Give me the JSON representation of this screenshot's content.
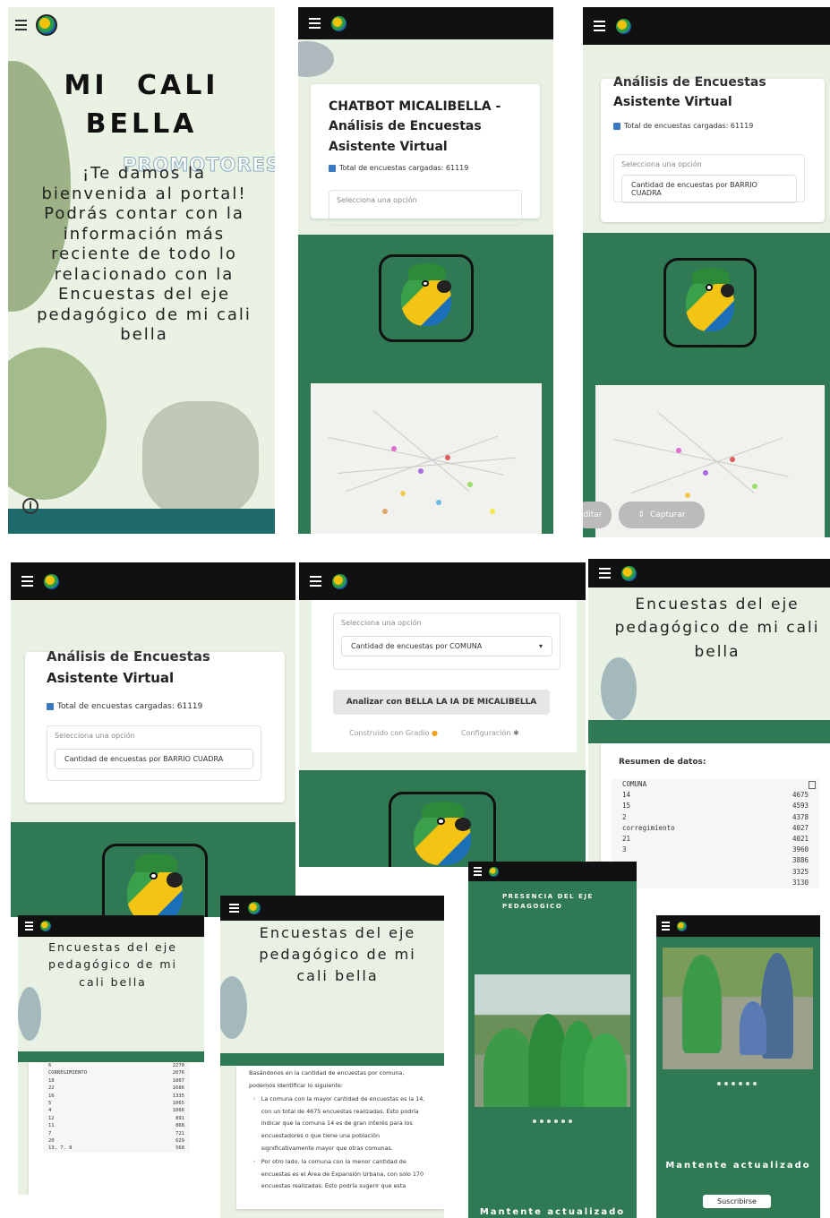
{
  "hero": {
    "title_line1": "MI CALI",
    "title_line2": "BELLA",
    "overlay": "PROMOTORES",
    "welcome": "¡Te damos la bienvenida al portal! Podrás contar con la información más reciente de todo lo relacionado con la Encuestas del eje pedagógico de mi cali bella",
    "info_icon": "info-circle-icon"
  },
  "chatbot": {
    "title_full": "CHATBOT MICALIBELLA - Análisis de Encuestas Asistente Virtual",
    "title_partial": "Análisis de Encuestas",
    "subtitle": "Asistente Virtual",
    "total": "Total de encuestas cargadas: 61119",
    "select_label": "Selecciona una opción",
    "option_barrio": "Cantidad de encuestas por BARRIO CUADRA",
    "option_comuna": "Cantidad de encuestas por COMUNA",
    "analyze_button": "Analizar con BELLA LA IA DE MICALIBELLA",
    "footer_built": "Construido con Gradio",
    "footer_config": "Configuración",
    "editar": "ditar",
    "capturar": "Capturar"
  },
  "eje": {
    "title": "Encuestas del eje pedagógico de mi cali bella",
    "summary_label": "Resumen de datos:",
    "table1": [
      [
        "COMUNA",
        ""
      ],
      [
        "14",
        "4675"
      ],
      [
        "15",
        "4593"
      ],
      [
        "2",
        "4378"
      ],
      [
        "corregimiento",
        "4027"
      ],
      [
        "21",
        "4021"
      ],
      [
        "3",
        "3960"
      ],
      [
        "",
        "3886"
      ],
      [
        "",
        "3325"
      ],
      [
        "",
        "3130"
      ]
    ],
    "table2": [
      [
        "6",
        "2270"
      ],
      [
        "CORREGIMIENTO",
        "2076"
      ],
      [
        "18",
        "1867"
      ],
      [
        "22",
        "1686"
      ],
      [
        "16",
        "1335"
      ],
      [
        "5",
        "1065"
      ],
      [
        "4",
        "1066"
      ],
      [
        "12",
        "891"
      ],
      [
        "11",
        "868"
      ],
      [
        "7",
        "721"
      ],
      [
        "20",
        "629"
      ],
      [
        "13, 7, 8",
        "568"
      ]
    ],
    "analysis_intro": "Basándonos en la cantidad de encuestas por comuna, podemos identificar lo siguiente:",
    "analysis_b1": "La comuna con la mayor cantidad de encuestas es la 14, con un total de 4675 encuestas realizadas. Esto podría indicar que la comuna 14 es de gran interés para los encuestadores o que tiene una población significativamente mayor que otras comunas.",
    "analysis_b2": "Por otro lado, la comuna con la menor cantidad de encuestas es el Área de Expansión Urbana, con solo 170 encuestas realizadas. Esto podría sugerir que esta"
  },
  "presencia": {
    "title": "PRESENCIA DEL EJE PEDAGOGICO",
    "stay_updated": "Mantente actualizado",
    "subscribe": "Suscribirse"
  },
  "colors": {
    "green": "#2f7a54",
    "black_bar": "#111111",
    "pale": "#e8f1e4"
  }
}
